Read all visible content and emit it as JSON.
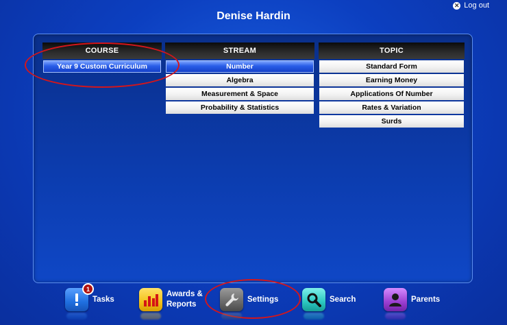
{
  "header": {
    "user_name": "Denise Hardin",
    "logout_label": "Log out",
    "logout_icon": "close-icon"
  },
  "columns": {
    "course": {
      "title": "COURSE",
      "items": [
        "Year 9 Custom Curriculum"
      ],
      "selected": "Year 9 Custom Curriculum"
    },
    "stream": {
      "title": "STREAM",
      "items": [
        "Number",
        "Algebra",
        "Measurement & Space",
        "Probability & Statistics"
      ],
      "selected": "Number"
    },
    "topic": {
      "title": "TOPIC",
      "items": [
        "Standard Form",
        "Earning Money",
        "Applications Of Number",
        "Rates & Variation",
        "Surds"
      ]
    }
  },
  "dock": {
    "items": [
      {
        "label": "Tasks",
        "icon": "tasks-icon",
        "badge": "1",
        "color": "#1f6fe0"
      },
      {
        "label_line1": "Awards &",
        "label_line2": "Reports",
        "icon": "bar-chart-icon",
        "color": "#f2c21b"
      },
      {
        "label": "Settings",
        "icon": "wrench-icon",
        "color": "#6a6a6a"
      },
      {
        "label": "Search",
        "icon": "search-icon",
        "color": "#2cc7c0"
      },
      {
        "label": "Parents",
        "icon": "person-icon",
        "color": "#9b3fd1"
      }
    ]
  },
  "colors": {
    "background": "#0c3fc0",
    "selection": "#1540c8",
    "highlight_ring": "#d4161b"
  }
}
